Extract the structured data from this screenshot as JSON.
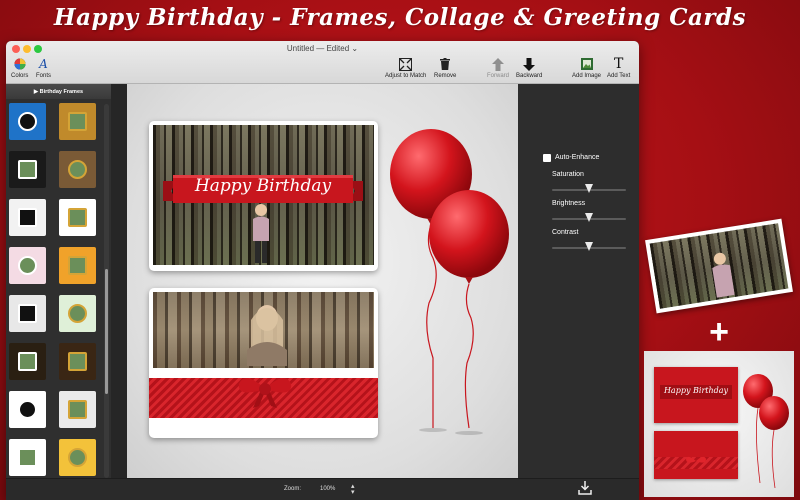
{
  "banner": {
    "title": "Happy Birthday - Frames, Collage & Greeting Cards"
  },
  "window": {
    "title": "Untitled — Edited",
    "title_chevron": "⌄"
  },
  "toolbar": {
    "colors_label": "Colors",
    "fonts_label": "Fonts",
    "adjust_label": "Adjust to Match",
    "remove_label": "Remove",
    "forward_label": "Forward",
    "backward_label": "Backward",
    "add_image_label": "Add Image",
    "add_text_label": "Add Text",
    "fonts_icon": "A",
    "add_text_icon": "T"
  },
  "sidebar": {
    "header": "▶ Birthday Frames",
    "thumbnails": [
      {
        "name": "thumb-cake-blue",
        "bg": "#1f73c8"
      },
      {
        "name": "thumb-floral-gold",
        "bg": "#c08a2b"
      },
      {
        "name": "thumb-gold-ring-black",
        "bg": "#1a1a1a"
      },
      {
        "name": "thumb-wood-frame",
        "bg": "#7a5a36"
      },
      {
        "name": "thumb-gold-circle-white",
        "bg": "#f2f2f2"
      },
      {
        "name": "thumb-red-balloon",
        "bg": "#ffffff"
      },
      {
        "name": "thumb-pink-balloons",
        "bg": "#f4dbe4"
      },
      {
        "name": "thumb-sunset-frame",
        "bg": "#f0a22a"
      },
      {
        "name": "thumb-confetti-balloons",
        "bg": "#e8e8e8"
      },
      {
        "name": "thumb-green-stars",
        "bg": "#dff0d8"
      },
      {
        "name": "thumb-gold-sparkle",
        "bg": "#2a1f12"
      },
      {
        "name": "thumb-lights",
        "bg": "#3a2614"
      },
      {
        "name": "thumb-blue-polka",
        "bg": "#ffffff"
      },
      {
        "name": "thumb-party-blue",
        "bg": "#eaeaea"
      },
      {
        "name": "thumb-confetti-white",
        "bg": "#ffffff"
      },
      {
        "name": "thumb-golden-circle",
        "bg": "#f3c23a"
      }
    ]
  },
  "canvas": {
    "card1_text": "Happy Birthday",
    "accent": "#c8161e"
  },
  "adjust": {
    "auto_enhance": "Auto-Enhance",
    "saturation": "Saturation",
    "brightness": "Brightness",
    "contrast": "Contrast",
    "saturation_level": 0.5,
    "brightness_level": 0.5,
    "contrast_level": 0.5
  },
  "bottom": {
    "zoom_label": "Zoom:",
    "zoom_value": "100%"
  },
  "promo": {
    "card_text": "Happy Birthday"
  },
  "icons": {
    "colors": "color-wheel-icon",
    "fonts": "font-icon",
    "adjust": "adjust-to-match-icon",
    "remove": "trash-icon",
    "forward": "arrow-up-icon",
    "backward": "arrow-down-icon",
    "add_image": "image-icon",
    "add_text": "text-icon",
    "download": "download-icon"
  }
}
